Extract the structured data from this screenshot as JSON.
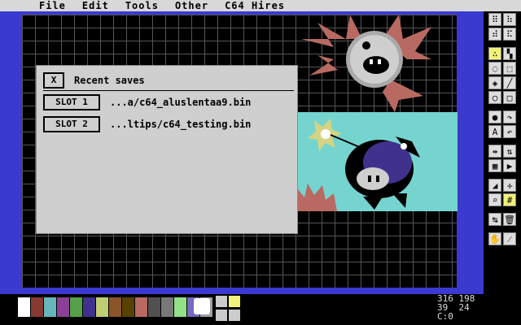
{
  "menu": {
    "items": [
      "File",
      "Edit",
      "Tools",
      "Other",
      "C64 Hires"
    ]
  },
  "dialog": {
    "close_label": "X",
    "title": "Recent saves",
    "slots": [
      {
        "label": "SLOT 1",
        "path": "...a/c64_aluslentaa9.bin"
      },
      {
        "label": "SLOT 2",
        "path": "...ltips/c64_testing.bin"
      }
    ]
  },
  "status": {
    "line1": "316 198",
    "line2": "39  24",
    "line3": "C:0"
  },
  "palette": [
    "#000000",
    "#ffffff",
    "#883932",
    "#67b6bd",
    "#8b3f96",
    "#55a049",
    "#40318d",
    "#bfce72",
    "#8b5429",
    "#574200",
    "#b86962",
    "#505050",
    "#787878",
    "#94e089",
    "#7869c4",
    "#9f9f9f"
  ],
  "colors": {
    "canvas_bg": "#000000",
    "border": "#3a3ad0",
    "dialog_bg": "#cfcfcf",
    "highlight": "#f2f27a",
    "teal": "#76d4cf"
  }
}
